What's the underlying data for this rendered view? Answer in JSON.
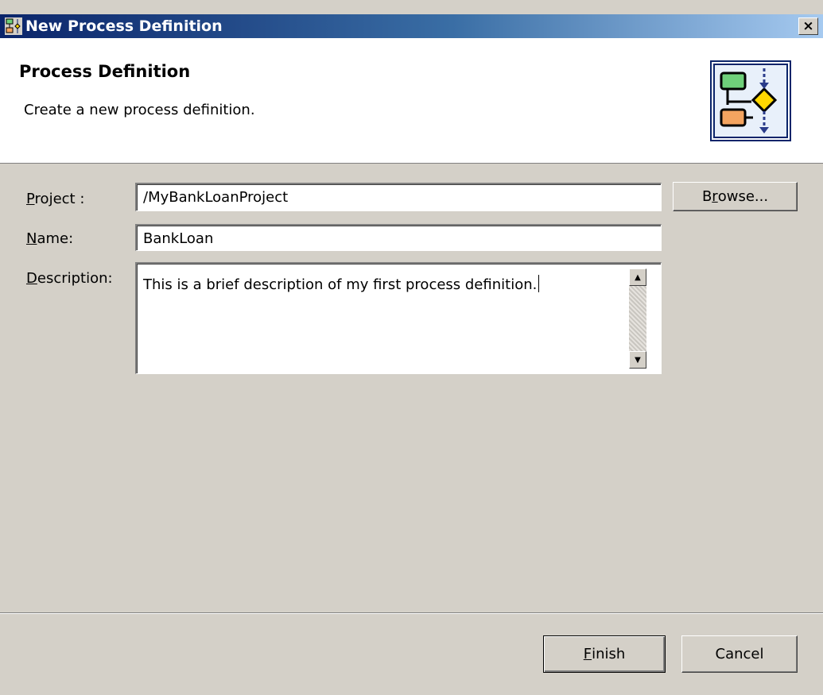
{
  "window": {
    "title": "New Process Definition",
    "close_label": "×"
  },
  "banner": {
    "title": "Process Definition",
    "description": "Create a new process definition.",
    "icon": "process-flow-icon"
  },
  "form": {
    "project": {
      "mnemonic": "P",
      "label_rest": "roject :",
      "value": "/MyBankLoanProject"
    },
    "name": {
      "mnemonic": "N",
      "label_rest": "ame:",
      "value": "BankLoan"
    },
    "description": {
      "mnemonic": "D",
      "label_rest": "escription:",
      "value": "This is a brief description of my first process definition."
    },
    "browse": {
      "pre": "B",
      "mnemonic": "r",
      "post": "owse..."
    }
  },
  "buttons": {
    "finish": {
      "mnemonic": "F",
      "rest": "inish"
    },
    "cancel": {
      "label": "Cancel"
    }
  },
  "colors": {
    "dialog": "#d4d0c8",
    "titlebar_start": "#0a246a",
    "titlebar_end": "#a6caf0",
    "banner_bg": "#ffffff"
  }
}
